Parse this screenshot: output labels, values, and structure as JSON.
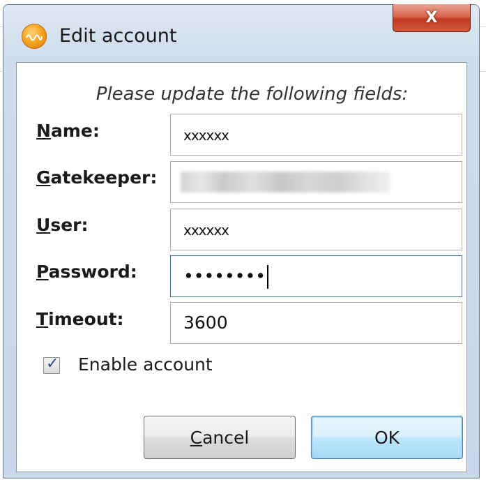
{
  "window": {
    "title": "Edit account",
    "close_label": "X"
  },
  "form": {
    "instruction": "Please update the following fields:",
    "fields": [
      {
        "label_mnemonic": "N",
        "label_rest": "ame:",
        "value": "xxxxxx"
      },
      {
        "label_mnemonic": "G",
        "label_rest": "atekeeper:",
        "value": ""
      },
      {
        "label_mnemonic": "U",
        "label_rest": "ser:",
        "value": "xxxxxx"
      },
      {
        "label_mnemonic": "P",
        "label_rest": "assword:",
        "value": "••••••••"
      },
      {
        "label_mnemonic": "T",
        "label_rest": "imeout:",
        "value": "3600"
      }
    ],
    "enable_account": {
      "label": "Enable account",
      "checked": true
    }
  },
  "buttons": {
    "cancel_mnemonic": "C",
    "cancel_rest": "ancel",
    "ok": "OK"
  },
  "icons": {
    "app": "app-logo-icon",
    "close": "close-icon",
    "check": "checkmark-icon"
  }
}
